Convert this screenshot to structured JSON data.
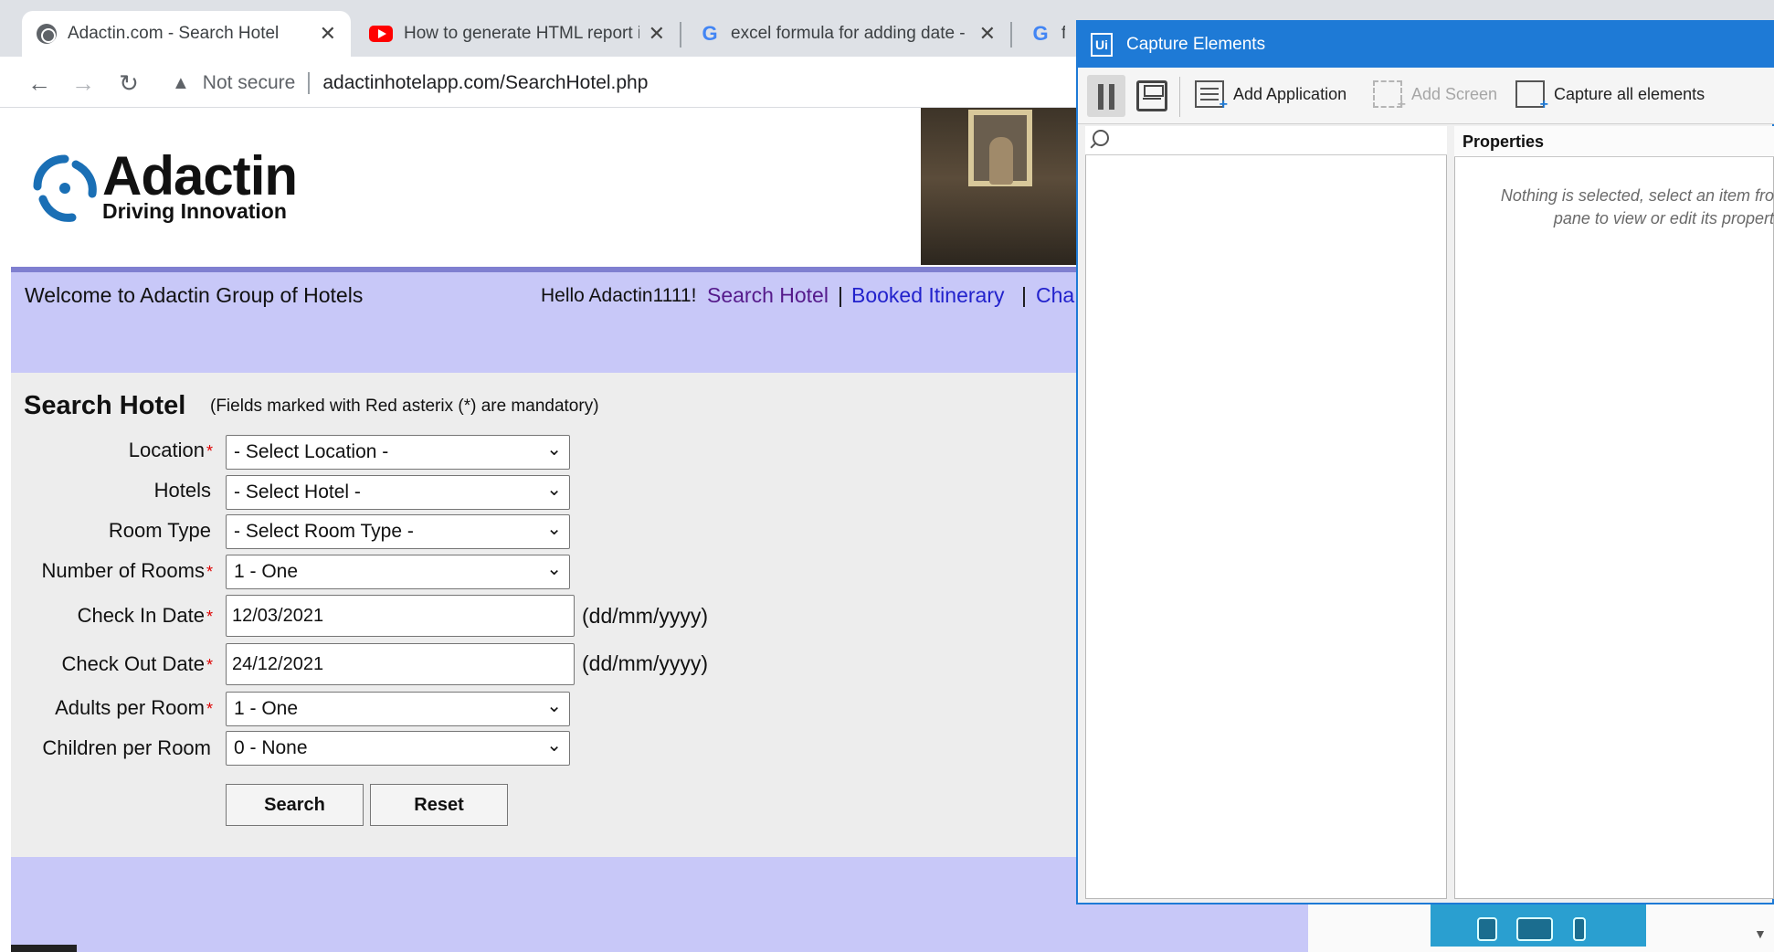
{
  "browser": {
    "tabs": [
      {
        "title": "Adactin.com - Search Hotel",
        "icon": "globe-icon",
        "active": true
      },
      {
        "title": "How to generate HTML report in",
        "icon": "youtube-icon",
        "active": false
      },
      {
        "title": "excel formula for adding date - C",
        "icon": "google-icon",
        "active": false
      },
      {
        "title": "fo",
        "icon": "google-icon",
        "active": false
      }
    ],
    "tab_close": "✕",
    "nav": {
      "back": "←",
      "forward": "→",
      "reload": "↻"
    },
    "security_label": "Not secure",
    "url": "adactinhotelapp.com/SearchHotel.php"
  },
  "site": {
    "logo_name": "Adactin",
    "logo_tagline": "Driving Innovation",
    "welcome": "Welcome to Adactin Group of Hotels",
    "hello": "Hello Adactin1111!",
    "nav_links": [
      "Search Hotel",
      "Booked Itinerary",
      "Cha"
    ],
    "nav_separator": "|"
  },
  "form": {
    "title": "Search Hotel",
    "note": "(Fields marked with Red asterix (*) are mandatory)",
    "required_marker": "*",
    "fields": {
      "location": {
        "label": "Location",
        "value": "- Select Location -"
      },
      "hotels": {
        "label": "Hotels",
        "value": "- Select Hotel -"
      },
      "room_type": {
        "label": "Room Type",
        "value": "- Select Room Type -"
      },
      "rooms": {
        "label": "Number of Rooms",
        "value": "1 - One"
      },
      "checkin": {
        "label": "Check In Date",
        "value": "12/03/2021",
        "hint": "(dd/mm/yyyy)"
      },
      "checkout": {
        "label": "Check Out Date",
        "value": "24/12/2021",
        "hint": "(dd/mm/yyyy)"
      },
      "adults": {
        "label": "Adults per Room",
        "value": "1 - One"
      },
      "children": {
        "label": "Children per Room",
        "value": "0 - None"
      }
    },
    "search_button": "Search",
    "reset_button": "Reset",
    "chevron": "⌄"
  },
  "capture_window": {
    "logo": "Ui",
    "title": "Capture Elements",
    "toolbar": {
      "add_application": "Add Application",
      "add_screen": "Add Screen",
      "capture_all": "Capture all elements"
    },
    "properties_title": "Properties",
    "properties_empty_line1": "Nothing is selected, select an item fro",
    "properties_empty_line2": "pane to view or edit its propert"
  },
  "colors": {
    "band": "#c8c8f8",
    "form_bg": "#ededed",
    "link": "#2222cc",
    "visited_link": "#551a8b",
    "required": "#dd0000",
    "capture_title_bar": "#1e7ad6"
  }
}
